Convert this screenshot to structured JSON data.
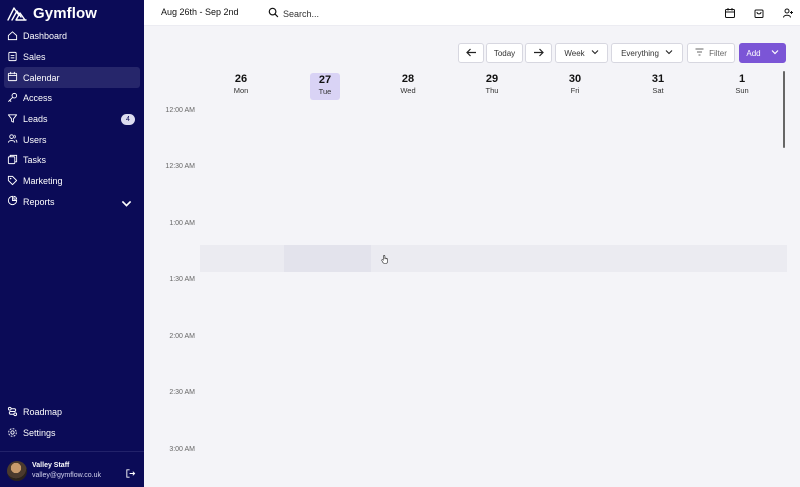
{
  "app": {
    "name": "Gymflow"
  },
  "sidebar": {
    "items": [
      {
        "label": "Dashboard",
        "icon": "home-icon"
      },
      {
        "label": "Sales",
        "icon": "receipt-icon"
      },
      {
        "label": "Calendar",
        "icon": "calendar-icon",
        "active": true
      },
      {
        "label": "Access",
        "icon": "key-icon"
      },
      {
        "label": "Leads",
        "icon": "funnel-icon",
        "badge": "4"
      },
      {
        "label": "Users",
        "icon": "users-icon"
      },
      {
        "label": "Tasks",
        "icon": "tasks-icon"
      },
      {
        "label": "Marketing",
        "icon": "tag-icon"
      },
      {
        "label": "Reports",
        "icon": "chart-icon",
        "expandable": true
      }
    ],
    "bottom": [
      {
        "label": "Roadmap",
        "icon": "roadmap-icon"
      },
      {
        "label": "Settings",
        "icon": "gear-icon"
      }
    ],
    "user": {
      "name": "Valley Staff",
      "email": "valley@gymflow.co.uk"
    }
  },
  "topbar": {
    "date_range": "Aug 26th - Sep 2nd",
    "search_placeholder": "Search..."
  },
  "toolbar": {
    "today": "Today",
    "view": "Week",
    "filter_scope": "Everything",
    "filter": "Filter",
    "add": "Add"
  },
  "calendar": {
    "days": [
      {
        "num": "26",
        "dow": "Mon"
      },
      {
        "num": "27",
        "dow": "Tue",
        "active": true
      },
      {
        "num": "28",
        "dow": "Wed"
      },
      {
        "num": "29",
        "dow": "Thu"
      },
      {
        "num": "30",
        "dow": "Fri"
      },
      {
        "num": "31",
        "dow": "Sat"
      },
      {
        "num": "1",
        "dow": "Sun"
      }
    ],
    "times": [
      "12:00 AM",
      "12:30 AM",
      "1:00 AM",
      "1:30 AM",
      "2:00 AM",
      "2:30 AM",
      "3:00 AM"
    ]
  },
  "colors": {
    "sidebar_bg": "#0b0b57",
    "accent": "#7b55d6",
    "today_highlight": "#d9d3f5"
  }
}
